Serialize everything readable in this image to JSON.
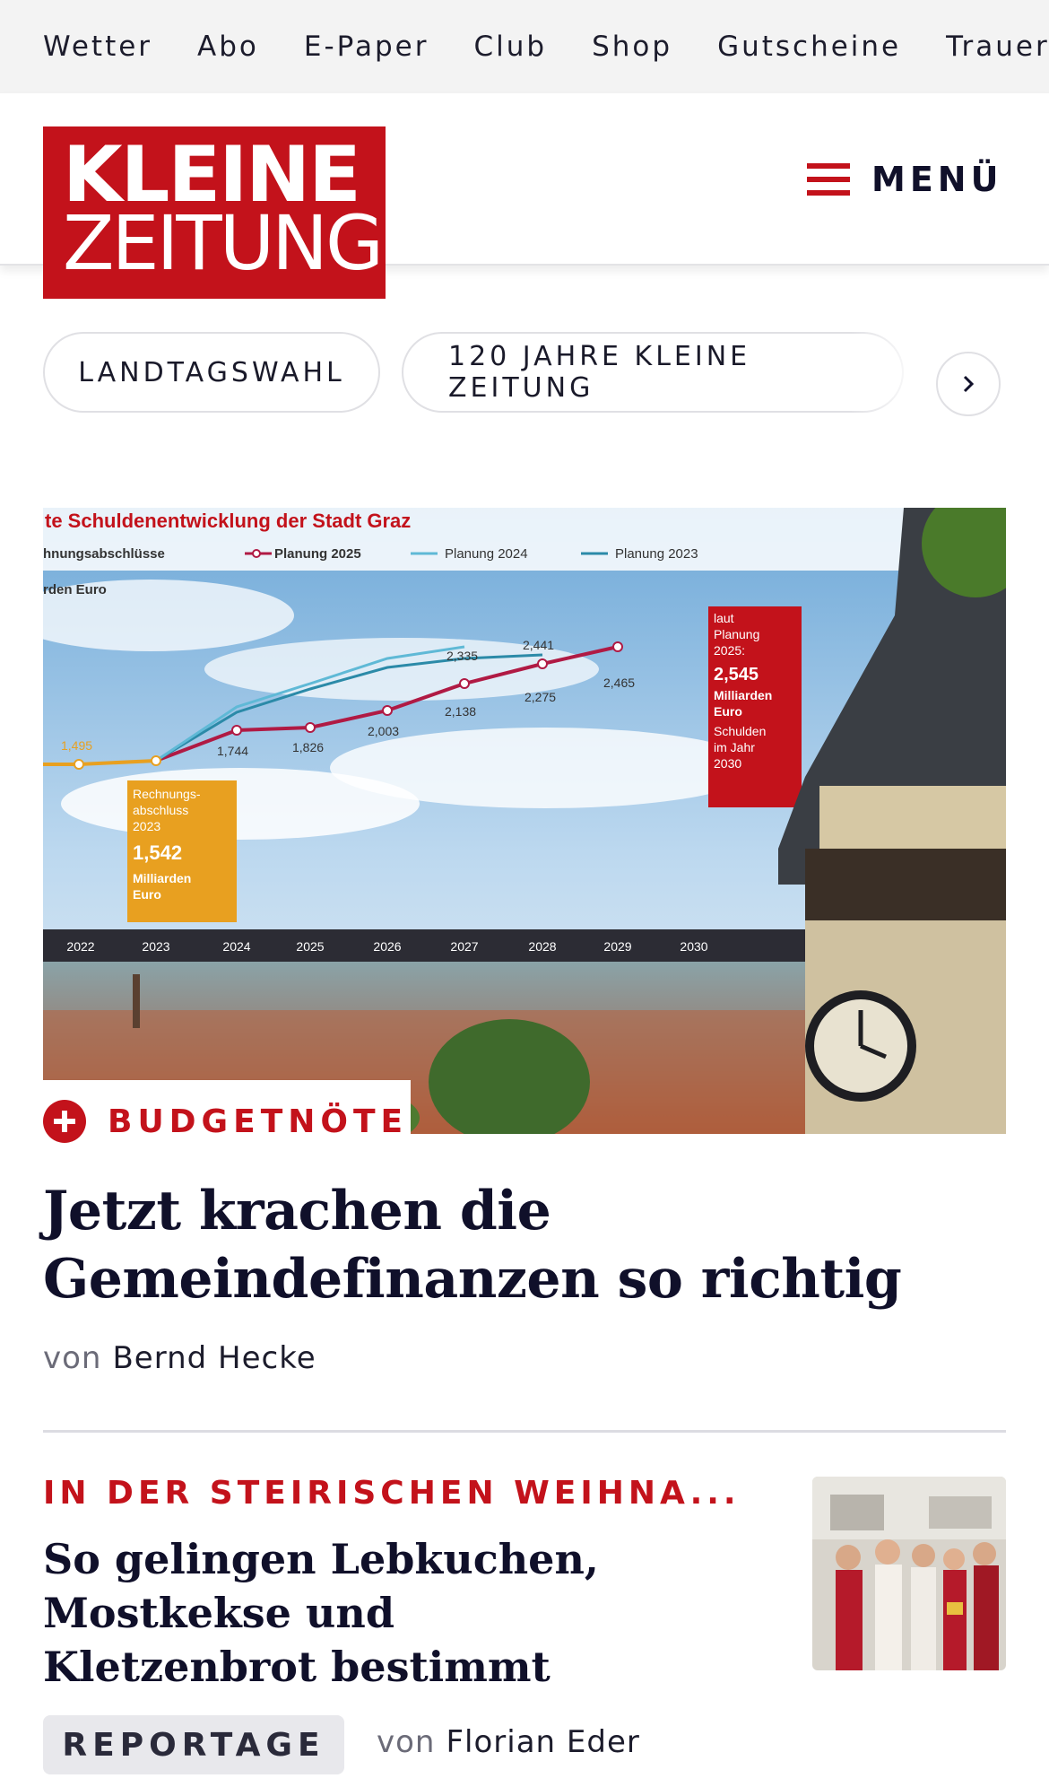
{
  "topnav": {
    "items": [
      "Wetter",
      "Abo",
      "E-Paper",
      "Club",
      "Shop",
      "Gutscheine",
      "Trauerp"
    ]
  },
  "header": {
    "logo_line1": "KLEINE",
    "logo_line2": "ZEITUNG",
    "menu_label": "MENÜ"
  },
  "chips": {
    "items": [
      "LANDTAGSWAHL",
      "120 JAHRE KLEINE ZEITUNG"
    ],
    "next_icon": "chevron-right-icon"
  },
  "hero": {
    "graphic": {
      "title": "te Schuldenentwicklung der Stadt Graz",
      "legend": [
        "hnungsabschlüsse",
        "Planung 2025",
        "Planung 2024",
        "Planung 2023"
      ],
      "unit": "rden Euro",
      "years": [
        "2022",
        "2023",
        "2024",
        "2025",
        "2026",
        "2027",
        "2028",
        "2029",
        "2030"
      ],
      "values_actual": [
        "1,495",
        "1,542"
      ],
      "values_2025": [
        "1,744",
        "1,826",
        "2,003",
        "2,138",
        "2,275",
        "2,465"
      ],
      "values_2024": [
        "2,335",
        "2,441"
      ],
      "box_left": [
        "Rechnungs-",
        "abschluss",
        "2023",
        "1,542",
        "Milliarden",
        "Euro"
      ],
      "box_right": [
        "laut",
        "Planung",
        "2025:",
        "2,545",
        "Milliarden",
        "Euro",
        "Schulden",
        "im Jahr",
        "2030"
      ]
    },
    "kicker": "BUDGETNÖTE",
    "headline_line1": "Jetzt krachen die",
    "headline_line2": "Gemeindefinanzen so richtig",
    "byline_prefix": "von",
    "author": "Bernd Hecke",
    "colors": {
      "brand": "#c3121b",
      "orange": "#e8a020"
    }
  },
  "article2": {
    "kicker": "IN DER STEIRISCHEN WEIHNA...",
    "headline_line1": "So gelingen Lebkuchen,",
    "headline_line2": "Mostkekse und",
    "headline_line3": "Kletzenbrot bestimmt",
    "badge": "REPORTAGE",
    "byline_prefix": "von",
    "author": "Florian Eder"
  }
}
